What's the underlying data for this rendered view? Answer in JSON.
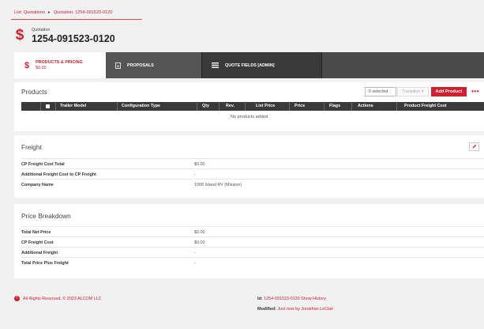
{
  "breadcrumb": {
    "list": "List: Quotations",
    "sep": "►",
    "current": "Quotation: 1254-091523-0120"
  },
  "quote": {
    "label": "Quotation",
    "number": "1254-091523-0120",
    "icon": "dollar-icon"
  },
  "tabs": [
    {
      "label": "PRODUCTS & PRICING",
      "amount": "$0.00",
      "icon": "dollar-icon"
    },
    {
      "label": "PROPOSALS",
      "icon": "document-icon"
    },
    {
      "label": "QUOTE FIELDS [ADMIN]",
      "icon": "list-icon"
    }
  ],
  "products": {
    "title": "Products",
    "selected": "0 selected",
    "transition": "Transition ▾",
    "add_label": "Add Product",
    "more": "•••",
    "columns": [
      "Trailer Model",
      "Configuration Type",
      "Qty",
      "Rev.",
      "List Price",
      "Price",
      "Flags",
      "Actions",
      "Product Freight Cost"
    ],
    "empty": "No products added"
  },
  "freight": {
    "title": "Freight",
    "rows": [
      {
        "label": "CP Freight Cost Total",
        "value": "$0.00"
      },
      {
        "label": "Additional Freight Cost to CP Freight",
        "value": "-"
      },
      {
        "label": "Company Name",
        "value": "1008 Island RV (Mission)"
      }
    ]
  },
  "price_breakdown": {
    "title": "Price Breakdown",
    "rows": [
      {
        "label": "Total Net Price",
        "value": "$0.00"
      },
      {
        "label": "CP Freight Cost",
        "value": "$0.00"
      },
      {
        "label": "Additional Freight",
        "value": "-"
      },
      {
        "label": "Total Price Plus Freight",
        "value": "-"
      }
    ]
  },
  "footer": {
    "copyright": "All Rights Reserved. © 2023 ALCOM LLC",
    "id_label": "Id:",
    "id_value": "1254-091523-0120",
    "history": "Show History",
    "modified_label": "Modified:",
    "modified_value": "Just now by Jonathan LeClair"
  },
  "colors": {
    "accent": "#d0202e",
    "tab_bar": "#3a3a3a"
  }
}
